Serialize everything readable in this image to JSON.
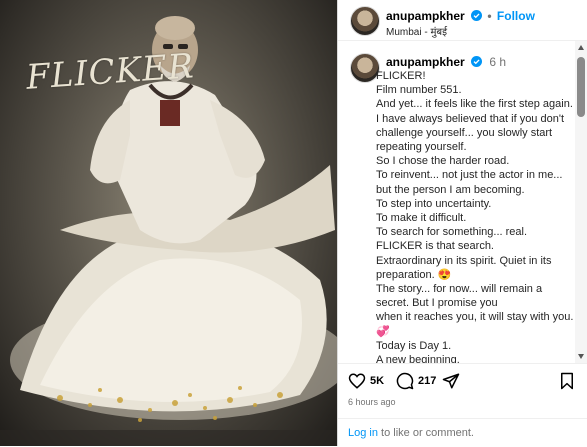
{
  "poster": {
    "title": "FLICKER"
  },
  "header": {
    "username": "anupampkher",
    "separator": "•",
    "follow_label": "Follow",
    "location": "Mumbai - मुंबई"
  },
  "post": {
    "username": "anupampkher",
    "time": "6 h",
    "caption_lines": [
      "FLICKER!",
      "Film number 551.",
      "And yet... it feels like the first step again.",
      "I have always believed that if you don't challenge yourself... you slowly start repeating yourself.",
      "So I chose the harder road.",
      "To reinvent... not just the actor in me... but the person I am becoming.",
      "To step into uncertainty.",
      "To make it difficult.",
      "To search for something... real.",
      "FLICKER is that search.",
      "Extraordinary in its spirit. Quiet in its preparation. 😍",
      "The story... for now... will remain a secret. But I promise you",
      "when it reaches you, it will stay with you. 💞",
      "Today is Day 1.",
      "A new beginning."
    ]
  },
  "actions": {
    "likes": "5K",
    "comments": "217"
  },
  "time_ago": "6 hours ago",
  "login": {
    "link": "Log in",
    "rest": " to like or comment."
  },
  "colors": {
    "link_blue": "#0095f6",
    "verified_blue": "#0095f6"
  },
  "icons": [
    "verified-badge-icon",
    "heart-icon",
    "comment-icon",
    "share-icon",
    "bookmark-icon"
  ]
}
